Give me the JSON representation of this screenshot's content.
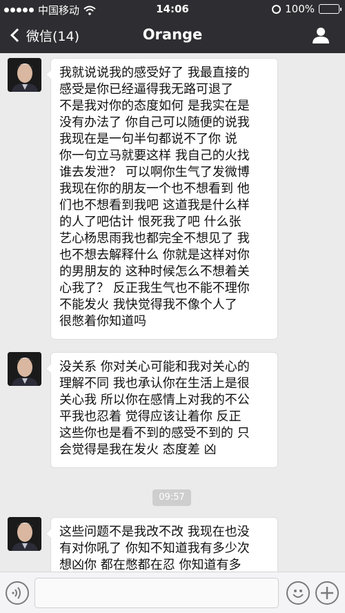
{
  "status_bar": {
    "carrier": "中国移动",
    "time": "14:06",
    "battery": "100%"
  },
  "nav": {
    "back_label": "微信(14)",
    "title": "Orange"
  },
  "messages": [
    {
      "lines": [
        "我就说说我的感受好了 我最直接的",
        "感受是你已经逼得我无路可退了",
        "不是我对你的态度如何 是我实在是",
        "没有办法了 你自己可以随便的说我",
        " 我现在是一句半句都说不了你 说",
        "你一句立马就要这样 我自己的火找",
        "谁去发泄？ 可以啊你生气了发微博",
        "我现在你的朋友一个也不想看到 他",
        "们也不想看到我吧 这道我是什么样",
        "的人了吧估计 恨死我了吧 什么张",
        "艺心杨思雨我也都完全不想见了 我",
        "也不想去解释什么 你就是这样对你",
        "的男朋友的 这种时候怎么不想着关",
        "心我了？ 反正我生气也不能不理你",
        "不能发火 我快觉得我不像个人了",
        "很憋着你知道吗"
      ]
    },
    {
      "lines": [
        "没关系 你对关心可能和我对关心的",
        "理解不同 我也承认你在生活上是很",
        "关心我 所以你在感情上对我的不公",
        "平我也忍着 觉得应该让着你 反正",
        "这些你也是看不到的感受不到的 只",
        "会觉得是我在发火 态度差 凶"
      ]
    },
    {
      "lines": [
        "这些问题不是我改不改 我现在也没",
        "有对你吼了 你知不知道我有多少次",
        "想凶你 都在憋都在忍 你知道有多"
      ]
    }
  ],
  "timestamp": "09:57",
  "input": {
    "value": ""
  }
}
